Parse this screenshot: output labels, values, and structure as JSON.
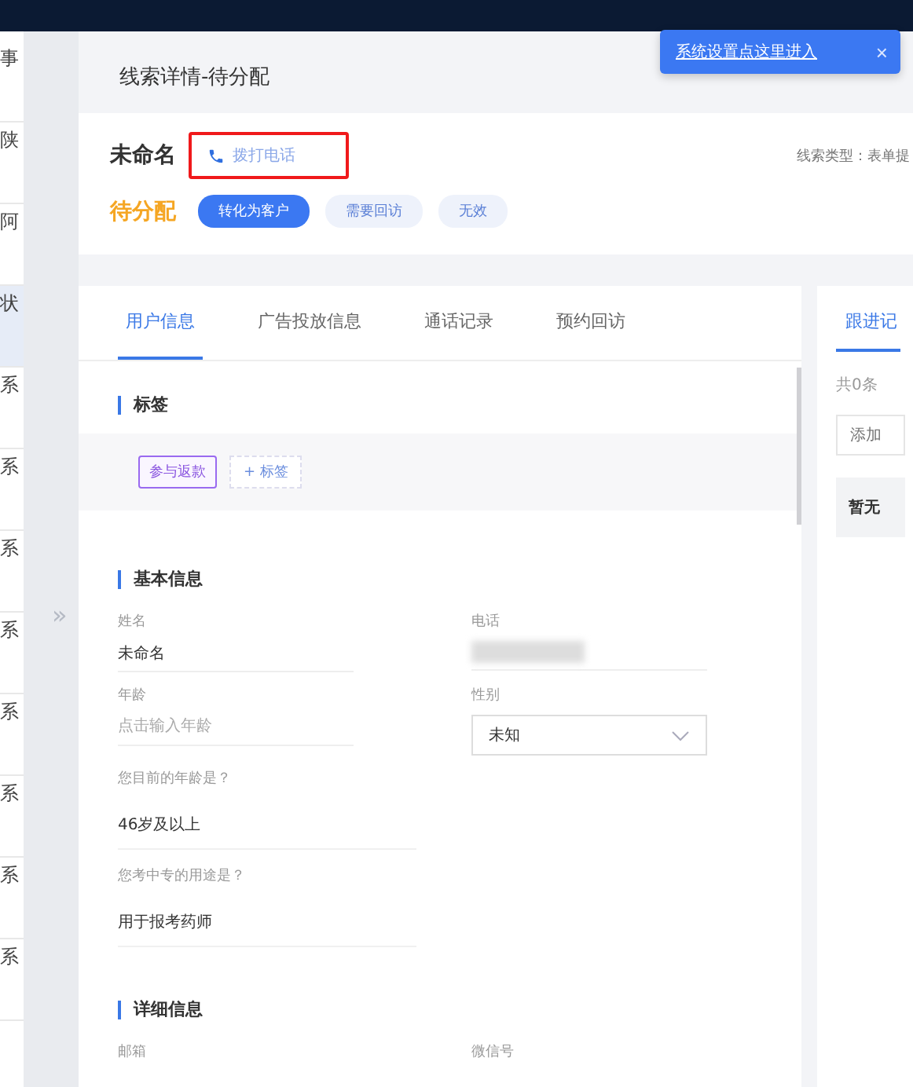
{
  "sidebar": {
    "items": [
      {
        "label": "事",
        "selected": false
      },
      {
        "label": "陕",
        "selected": false
      },
      {
        "label": "阿",
        "selected": false
      },
      {
        "label": "状",
        "selected": true
      },
      {
        "label": "系",
        "selected": false
      },
      {
        "label": "系",
        "selected": false
      },
      {
        "label": "系",
        "selected": false
      },
      {
        "label": "系",
        "selected": false
      },
      {
        "label": "系",
        "selected": false
      },
      {
        "label": "系",
        "selected": false
      },
      {
        "label": "系",
        "selected": false
      },
      {
        "label": "系",
        "selected": false
      }
    ]
  },
  "collapse_handle": "»",
  "drawer": {
    "title": "线索详情-待分配"
  },
  "tooltip": {
    "text": "系统设置点这里进入",
    "close": "×"
  },
  "header": {
    "name": "未命名",
    "call_link": "拨打电话",
    "highlighted": true,
    "lead_type": "线索类型：表单提",
    "status": "待分配",
    "actions": [
      {
        "label": "转化为客户",
        "primary": true
      },
      {
        "label": "需要回访",
        "primary": false
      },
      {
        "label": "无效",
        "primary": false
      }
    ]
  },
  "tabs": [
    {
      "label": "用户信息",
      "selected": true
    },
    {
      "label": "广告投放信息",
      "selected": false
    },
    {
      "label": "通话记录",
      "selected": false
    },
    {
      "label": "预约回访",
      "selected": false
    }
  ],
  "tags_section": {
    "title": "标签",
    "tags": [
      "参与返款"
    ],
    "add_label": "+ 标签"
  },
  "basic_section": {
    "title": "基本信息",
    "fields": [
      {
        "kind": "text",
        "label": "姓名",
        "value": "未命名"
      },
      {
        "kind": "blurred",
        "label": "电话"
      },
      {
        "kind": "text",
        "label": "年龄",
        "placeholder": "点击输入年龄"
      },
      {
        "kind": "select",
        "label": "性别",
        "value": "未知"
      }
    ],
    "questions": [
      {
        "question": "您目前的年龄是？",
        "answer": "46岁及以上"
      },
      {
        "question": "您考中专的用途是？",
        "answer": "用于报考药师"
      }
    ]
  },
  "detail_section": {
    "title": "详细信息",
    "labels": [
      "邮箱",
      "微信号"
    ]
  },
  "right_panel": {
    "tab": "跟进记",
    "count": "共0条",
    "input_placeholder": "添加",
    "empty": "暂无"
  }
}
